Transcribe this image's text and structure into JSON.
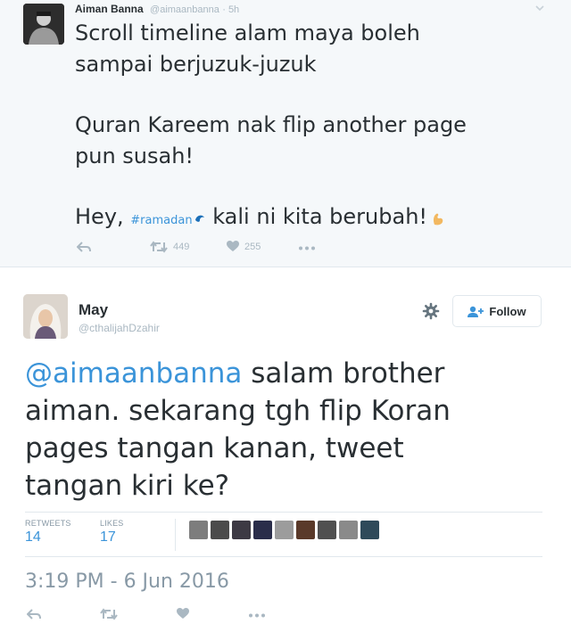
{
  "quoted_tweet": {
    "author_name": "Aiman Banna",
    "author_handle": "@aimaanbanna",
    "time": "· 5h",
    "lines": [
      "Scroll timeline alam maya boleh",
      "sampai berjuzuk-juzuk",
      "Quran Kareem nak flip another page",
      "pun susah!"
    ],
    "last_line_prefix": "Hey, ",
    "hashtag": "#ramadan",
    "last_line_suffix": " kali ni kita berubah!",
    "retweets": "449",
    "likes": "255",
    "icons": [
      "reply-icon",
      "retweet-icon",
      "heart-icon",
      "more-icon",
      "caret-down-icon",
      "wave-icon",
      "flexed-biceps-emoji"
    ]
  },
  "tweet": {
    "author_name": "May",
    "author_handle": "@cthalijahDzahir",
    "follow_label": "Follow",
    "mention": "@aimaanbanna",
    "line1_rest": " salam brother",
    "lines": [
      "aiman. sekarang tgh flip Koran",
      "pages tangan kanan, tweet",
      "tangan kiri ke?"
    ],
    "retweets_label": "RETWEETS",
    "retweets_count": "14",
    "likes_label": "LIKES",
    "likes_count": "17",
    "liker_colors": [
      "#7d7d7d",
      "#4b4b4b",
      "#3d3a44",
      "#2a2d4a",
      "#9c9c9c",
      "#5a3a2a",
      "#505050",
      "#8a8a8a",
      "#2f4a5a"
    ],
    "timestamp": "3:19 PM - 6 Jun 2016",
    "icons": [
      "gear-icon",
      "add-user-icon",
      "reply-icon",
      "retweet-icon",
      "heart-icon",
      "more-icon"
    ]
  },
  "colors": {
    "link_blue": "#3b94d9",
    "muted_gray": "#aab8c2",
    "quoted_background": "#f5f8fa"
  }
}
